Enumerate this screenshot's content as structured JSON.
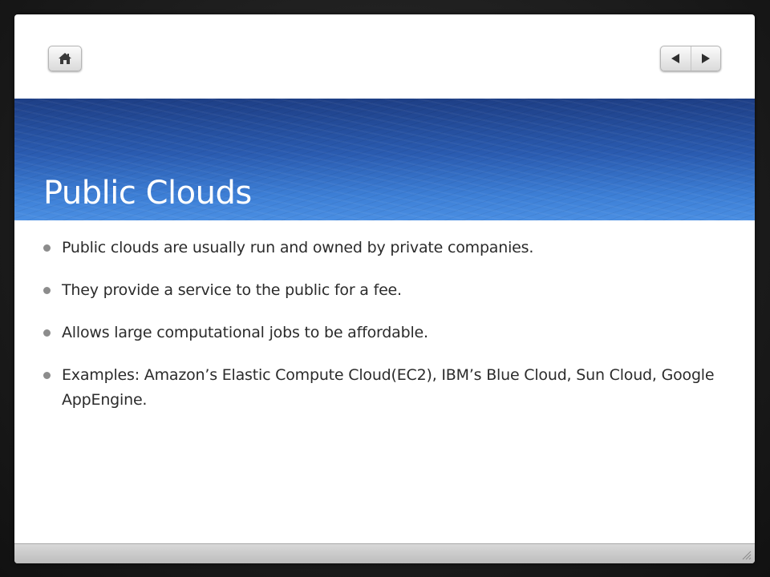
{
  "slide": {
    "title": "Public Clouds",
    "bullets": [
      "Public clouds are usually run and owned by private companies.",
      "They provide a service to the public for a fee.",
      "Allows large computational jobs to be affordable.",
      "Examples: Amazon’s Elastic Compute Cloud(EC2), IBM’s Blue Cloud, Sun Cloud, Google AppEngine."
    ]
  },
  "nav": {
    "home_icon": "home-icon",
    "prev_icon": "triangle-left-icon",
    "next_icon": "triangle-right-icon"
  },
  "colors": {
    "banner_top": "#1e3f86",
    "banner_bottom": "#4a8ee2",
    "bullet_dot": "#8c8c8c",
    "body_text": "#2b2b2b"
  }
}
